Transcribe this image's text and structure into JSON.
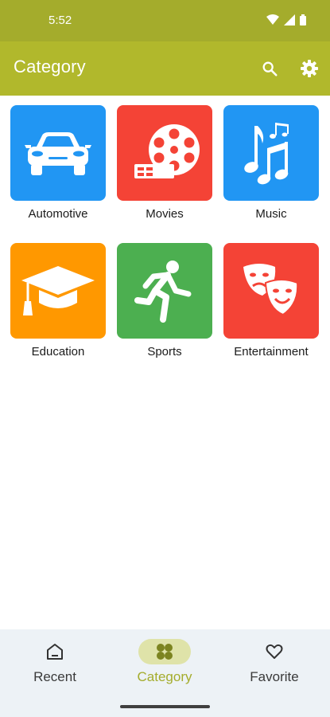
{
  "status": {
    "time": "5:52"
  },
  "appbar": {
    "title": "Category"
  },
  "categories": [
    {
      "label": "Automotive",
      "color": "#2196f3",
      "icon": "car-icon"
    },
    {
      "label": "Movies",
      "color": "#f44336",
      "icon": "film-reel-icon"
    },
    {
      "label": "Music",
      "color": "#2196f3",
      "icon": "music-notes-icon"
    },
    {
      "label": "Education",
      "color": "#ff9800",
      "icon": "graduation-cap-icon"
    },
    {
      "label": "Sports",
      "color": "#4caf50",
      "icon": "running-person-icon"
    },
    {
      "label": "Entertainment",
      "color": "#f44336",
      "icon": "theater-masks-icon"
    }
  ],
  "bottom_nav": {
    "items": [
      {
        "label": "Recent",
        "icon": "home-icon"
      },
      {
        "label": "Category",
        "icon": "grid-icon"
      },
      {
        "label": "Favorite",
        "icon": "heart-icon"
      }
    ],
    "active_index": 1
  },
  "colors": {
    "accent": "#b1b82c",
    "status_bar": "#a4ac2c",
    "nav_bg": "#edf2f6"
  }
}
